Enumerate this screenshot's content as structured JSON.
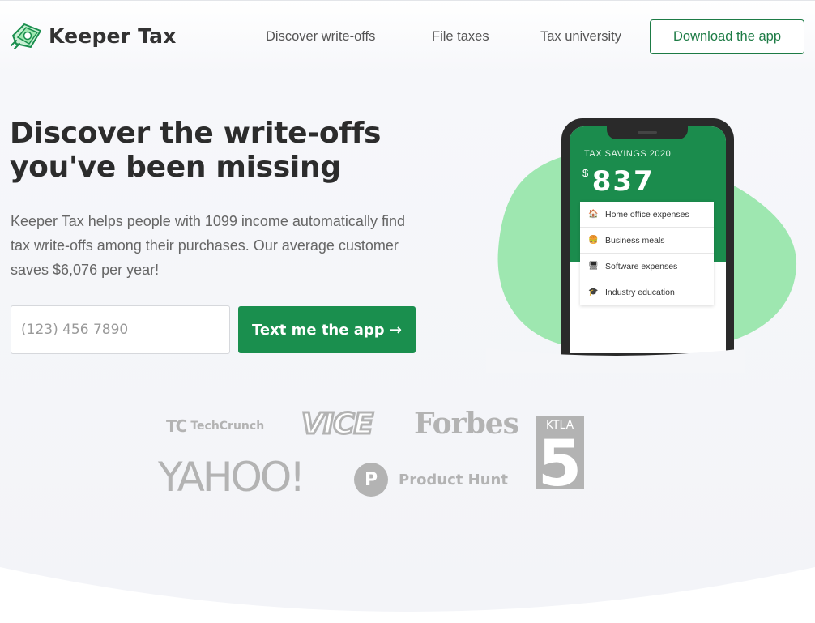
{
  "header": {
    "brand": "Keeper Tax",
    "nav": [
      "Discover write-offs",
      "File taxes",
      "Tax university"
    ],
    "download_label": "Download the app"
  },
  "hero": {
    "title_line1": "Discover the write-offs",
    "title_line2": "you've been missing",
    "subtitle": "Keeper Tax helps people with 1099 income automatically find tax write-offs among their purchases. Our average customer saves $6,076 per year!",
    "phone_placeholder": "(123) 456 7890",
    "cta_label": "Text me the app →"
  },
  "phone_mock": {
    "savings_label": "TAX SAVINGS 2020",
    "currency": "$",
    "savings_amount": "837",
    "items": [
      {
        "icon": "house-icon",
        "glyph": "🏠",
        "label": "Home office expenses"
      },
      {
        "icon": "burger-icon",
        "glyph": "🍔",
        "label": "Business meals"
      },
      {
        "icon": "computer-icon",
        "glyph": "🖥",
        "label": "Software expenses"
      },
      {
        "icon": "graduation-cap-icon",
        "glyph": "🎓",
        "label": "Industry education"
      }
    ]
  },
  "press": {
    "techcrunch_mark": "TC",
    "techcrunch": "TechCrunch",
    "vice": "VICE",
    "forbes": "Forbes",
    "ktla": "KTLA",
    "ktla_number": "5",
    "yahoo": "YAHOO!",
    "producthunt_mark": "P",
    "producthunt": "Product Hunt"
  },
  "colors": {
    "brand_green": "#1a8f4e",
    "blob_green": "#9ee7b0",
    "press_gray": "#b3b3b3"
  }
}
